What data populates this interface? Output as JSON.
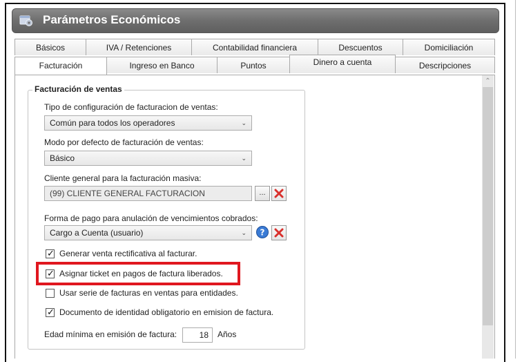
{
  "window": {
    "title": "Parámetros Económicos",
    "icon": "settings-window-icon"
  },
  "tabs_row1": [
    {
      "label": "Básicos"
    },
    {
      "label": "IVA / Retenciones"
    },
    {
      "label": "Contabilidad financiera"
    },
    {
      "label": "Descuentos"
    },
    {
      "label": "Domiciliación"
    }
  ],
  "tabs_row2": [
    {
      "label": "Facturación",
      "active": true
    },
    {
      "label": "Ingreso en Banco"
    },
    {
      "label": "Puntos"
    },
    {
      "label": "Dinero a cuenta"
    },
    {
      "label": "Descripciones"
    }
  ],
  "group": {
    "title": "Facturación de ventas",
    "tipo_config": {
      "label": "Tipo de configuración de facturacion de ventas:",
      "value": "Común para todos los operadores"
    },
    "modo_defecto": {
      "label": "Modo por defecto de facturación de ventas:",
      "value": "Básico"
    },
    "cliente_general": {
      "label": "Cliente general para la facturación masiva:",
      "value": "(99) CLIENTE GENERAL FACTURACION",
      "browse_label": "..."
    },
    "forma_pago": {
      "label": "Forma de pago para anulación de vencimientos cobrados:",
      "value": "Cargo a Cuenta (usuario)"
    },
    "checks": [
      {
        "label": "Generar venta rectificativa al facturar.",
        "checked": true
      },
      {
        "label": "Asignar ticket en pagos de factura liberados.",
        "checked": true
      },
      {
        "label": "Usar serie de facturas en ventas para entidades.",
        "checked": false
      },
      {
        "label": "Documento de identidad obligatorio en emision de factura.",
        "checked": true
      }
    ],
    "edad_minima": {
      "label": "Edad mínima en emisión de factura:",
      "value": "18",
      "unit": "Años"
    }
  },
  "colors": {
    "highlight": "#e0171f",
    "titlebar": "#6e6e6e",
    "delete": "#d9302c",
    "help": "#3a7bd5"
  }
}
